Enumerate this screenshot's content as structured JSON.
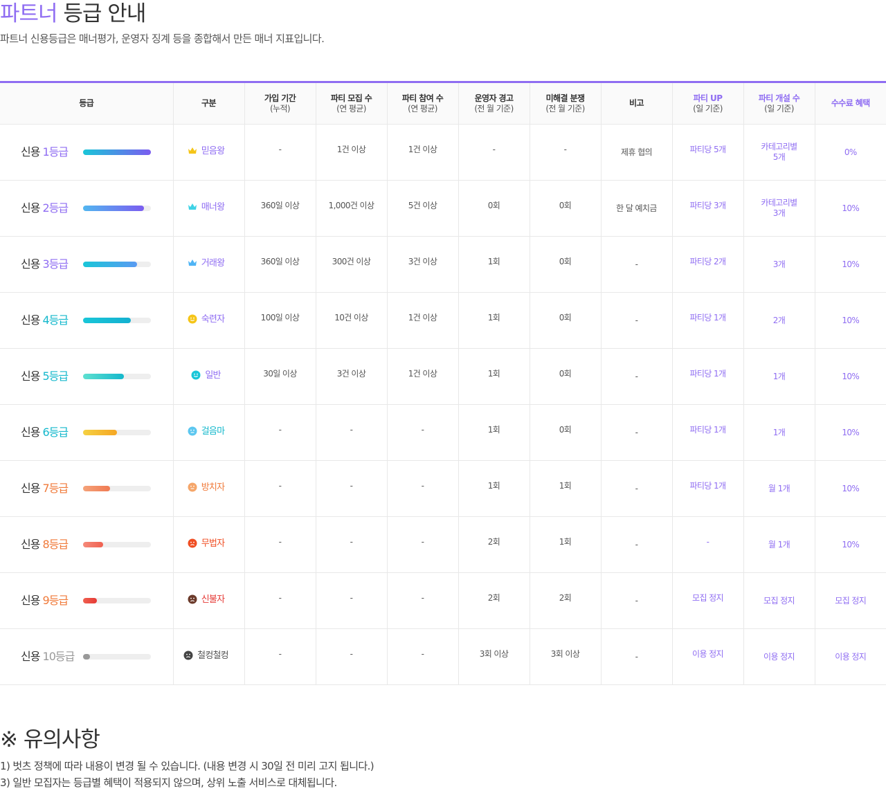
{
  "title": {
    "accent": "파트너",
    "rest": " 등급 안내"
  },
  "subtitle": "파트너 신용등급은 매너평가, 운영자 징계 등을 종합해서  만든 매너 지표입니다.",
  "table": {
    "headers": {
      "grade": "등급",
      "type": "구분",
      "join": {
        "main": "가입 기간",
        "sub": "(누적)"
      },
      "recruit": {
        "main": "파티 모집 수",
        "sub": "(연 평균)"
      },
      "participate": {
        "main": "파티 참여 수",
        "sub": "(연 평균)"
      },
      "warning": {
        "main": "운영자 경고",
        "sub": "(전 월 기준)"
      },
      "dispute": {
        "main": "미해결 분쟁",
        "sub": "(전 월 기준)"
      },
      "note": "비고",
      "party_up": {
        "main": "파티 UP",
        "sub": "(일 기준)"
      },
      "party_open": {
        "main": "파티 개설 수",
        "sub": "(일 기준)"
      },
      "fee": "수수료 혜택"
    },
    "rows": [
      {
        "grade_prefix": "신용 ",
        "grade_num": "1등급",
        "grade_color": "#8f6df2",
        "level": 1.0,
        "bar_from": "#19c6d8",
        "bar_to": "#7b5cf0",
        "type_label": "믿음왕",
        "type_icon": "crown-icon",
        "type_color": "#8f6df2",
        "icon_color": "#f5c518",
        "join": "-",
        "recruit": "1건 이상",
        "participate": "1건 이상",
        "warning": "-",
        "dispute": "-",
        "note": "제휴 협의",
        "party_up": "파티당 5개",
        "party_open_1": "카테고리별",
        "party_open_2": "5개",
        "fee": "0%"
      },
      {
        "grade_prefix": "신용 ",
        "grade_num": "2등급",
        "grade_color": "#8f6df2",
        "level": 0.9,
        "bar_from": "#52b7f0",
        "bar_to": "#7b5cf0",
        "type_label": "매너왕",
        "type_icon": "crown-icon",
        "type_color": "#8f6df2",
        "icon_color": "#3fd3e6",
        "join": "360일 이상",
        "recruit": "1,000건 이상",
        "participate": "5건 이상",
        "warning": "0회",
        "dispute": "0회",
        "note": "한 달 예치금",
        "party_up": "파티당 3개",
        "party_open_1": "카테고리별",
        "party_open_2": "3개",
        "fee": "10%"
      },
      {
        "grade_prefix": "신용 ",
        "grade_num": "3등급",
        "grade_color": "#8f6df2",
        "level": 0.8,
        "bar_from": "#19c6d8",
        "bar_to": "#5a9af2",
        "type_label": "거래왕",
        "type_icon": "crown-icon",
        "type_color": "#8f6df2",
        "icon_color": "#4fb4f5",
        "join": "360일 이상",
        "recruit": "300건 이상",
        "participate": "3건 이상",
        "warning": "1회",
        "dispute": "0회",
        "note": "-",
        "party_up": "파티당 2개",
        "party_open_1": "3개",
        "party_open_2": "",
        "fee": "10%"
      },
      {
        "grade_prefix": "신용 ",
        "grade_num": "4등급",
        "grade_color": "#14b8cc",
        "level": 0.7,
        "bar_from": "#19c6d8",
        "bar_to": "#14b0d0",
        "type_label": "숙련자",
        "type_icon": "smile-face-icon",
        "type_color": "#8f6df2",
        "icon_color": "#f5c518",
        "join": "100일 이상",
        "recruit": "10건 이상",
        "participate": "1건 이상",
        "warning": "1회",
        "dispute": "0회",
        "note": "-",
        "party_up": "파티당 1개",
        "party_open_1": "2개",
        "party_open_2": "",
        "fee": "10%"
      },
      {
        "grade_prefix": "신용 ",
        "grade_num": "5등급",
        "grade_color": "#14b8cc",
        "level": 0.6,
        "bar_from": "#5ee0d0",
        "bar_to": "#14b8cc",
        "type_label": "일반",
        "type_icon": "smile-face-icon",
        "type_color": "#8f6df2",
        "icon_color": "#19c6d8",
        "join": "30일 이상",
        "recruit": "3건 이상",
        "participate": "1건 이상",
        "warning": "1회",
        "dispute": "0회",
        "note": "-",
        "party_up": "파티당 1개",
        "party_open_1": "1개",
        "party_open_2": "",
        "fee": "10%"
      },
      {
        "grade_prefix": "신용 ",
        "grade_num": "6등급",
        "grade_color": "#14b8cc",
        "level": 0.5,
        "bar_from": "#f5d142",
        "bar_to": "#f5a623",
        "type_label": "걸음마",
        "type_icon": "neutral-face-icon",
        "type_color": "#14b8cc",
        "icon_color": "#5cc7f0",
        "join": "-",
        "recruit": "-",
        "participate": "-",
        "warning": "1회",
        "dispute": "0회",
        "note": "-",
        "party_up": "파티당 1개",
        "party_open_1": "1개",
        "party_open_2": "",
        "fee": "10%"
      },
      {
        "grade_prefix": "신용 ",
        "grade_num": "7등급",
        "grade_color": "#f07a3a",
        "level": 0.4,
        "bar_from": "#f5a37a",
        "bar_to": "#f07a52",
        "type_label": "방치자",
        "type_icon": "neutral-face-icon",
        "type_color": "#f07a3a",
        "icon_color": "#f5a66a",
        "join": "-",
        "recruit": "-",
        "participate": "-",
        "warning": "1회",
        "dispute": "1회",
        "note": "-",
        "party_up": "파티당 1개",
        "party_open_1": "월 1개",
        "party_open_2": "",
        "fee": "10%"
      },
      {
        "grade_prefix": "신용 ",
        "grade_num": "8등급",
        "grade_color": "#f07a3a",
        "level": 0.3,
        "bar_from": "#f58a7a",
        "bar_to": "#f0604f",
        "type_label": "무법자",
        "type_icon": "sad-face-icon",
        "type_color": "#f04e23",
        "icon_color": "#f04e23",
        "join": "-",
        "recruit": "-",
        "participate": "-",
        "warning": "2회",
        "dispute": "1회",
        "note": "-",
        "party_up": "-",
        "party_open_1": "월 1개",
        "party_open_2": "",
        "fee": "10%"
      },
      {
        "grade_prefix": "신용 ",
        "grade_num": "9등급",
        "grade_color": "#f07a3a",
        "level": 0.2,
        "bar_from": "#f0604f",
        "bar_to": "#e53935",
        "type_label": "신불자",
        "type_icon": "sad-face-icon",
        "type_color": "#e53935",
        "icon_color": "#6b3a2a",
        "join": "-",
        "recruit": "-",
        "participate": "-",
        "warning": "2회",
        "dispute": "2회",
        "note": "-",
        "party_up": "모집 정지",
        "party_open_1": "모집 정지",
        "party_open_2": "",
        "fee": "모집 정지"
      },
      {
        "grade_prefix": "신용 ",
        "grade_num": "10등급",
        "grade_color": "#999999",
        "level": 0.1,
        "bar_from": "#999999",
        "bar_to": "#999999",
        "type_label": "철컹철컹",
        "type_icon": "sad-face-icon",
        "type_color": "#555555",
        "icon_color": "#444444",
        "join": "-",
        "recruit": "-",
        "participate": "-",
        "warning": "3회 이상",
        "dispute": "3회 이상",
        "note": "-",
        "party_up": "이용 정지",
        "party_open_1": "이용 정지",
        "party_open_2": "",
        "fee": "이용 정지"
      }
    ]
  },
  "notes": {
    "title": "※ 유의사항",
    "items": [
      "1) 벗츠 정책에 따라 내용이 변경 될 수 있습니다. (내용 변경 시 30일 전 미리 고지 됩니다.)",
      "3) 일반 모집자는 등급별 혜택이 적용되지 않으며, 상위 노출 서비스로 대체됩니다."
    ]
  },
  "colors": {
    "accent": "#8f6df2",
    "border": "#e8e8e8",
    "text": "#333333"
  }
}
